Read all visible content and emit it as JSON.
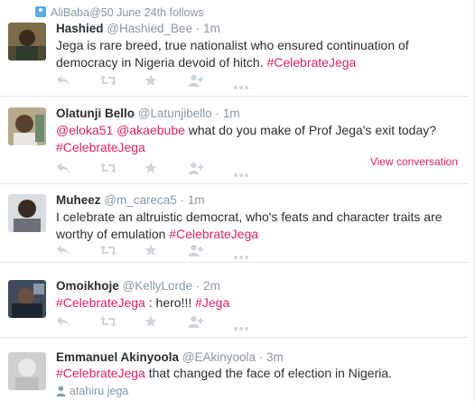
{
  "context": {
    "label": "AliBaba@50 June 24th follows",
    "icon": "user-follow-icon"
  },
  "tweets": [
    {
      "fullname": "Hashied",
      "username": "@Hashied_Bee",
      "time": "1m",
      "parts": [
        {
          "t": "Jega is rare breed, true nationalist who ensured continuation of democracy in Nigeria devoid of hitch. "
        },
        {
          "t": "#CelebrateJega",
          "k": "hashtag"
        }
      ]
    },
    {
      "fullname": "Olatunji Bello",
      "username": "@Latunjibello",
      "time": "1m",
      "parts": [
        {
          "t": "@eloka51",
          "k": "mention"
        },
        {
          "t": " "
        },
        {
          "t": "@akaebube",
          "k": "mention"
        },
        {
          "t": " what do you make of Prof Jega's exit today? "
        },
        {
          "t": "#CelebrateJega",
          "k": "hashtag"
        }
      ],
      "view_conversation": "View conversation"
    },
    {
      "fullname": "Muheez",
      "username": "@m_careca5",
      "time": "1m",
      "parts": [
        {
          "t": "I celebrate an altruistic democrat, who's feats and character traits are worthy of emulation "
        },
        {
          "t": "#CelebrateJega",
          "k": "hashtag"
        }
      ]
    },
    {
      "fullname": "Omoikhoje",
      "username": "@KellyLorde",
      "time": "2m",
      "parts": [
        {
          "t": "#CelebrateJega",
          "k": "hashtag"
        },
        {
          "t": " : hero!!! "
        },
        {
          "t": "#Jega",
          "k": "hashtag"
        }
      ]
    },
    {
      "fullname": "Emmanuel Akinyoola",
      "username": "@EAkinyoola",
      "time": "3m",
      "parts": [
        {
          "t": "#CelebrateJega",
          "k": "hashtag"
        },
        {
          "t": " that changed the face of election in Nigeria."
        }
      ],
      "context_line": "atahiru jega"
    }
  ],
  "separator": "·",
  "action_icons": [
    "reply-icon",
    "retweet-icon",
    "favorite-icon",
    "follow-icon",
    "more-icon"
  ],
  "colors": {
    "link": "#e0245e",
    "meta": "#8899a6",
    "text": "#292f33",
    "icon": "#ccd6dd",
    "border": "#e1e8ed"
  }
}
